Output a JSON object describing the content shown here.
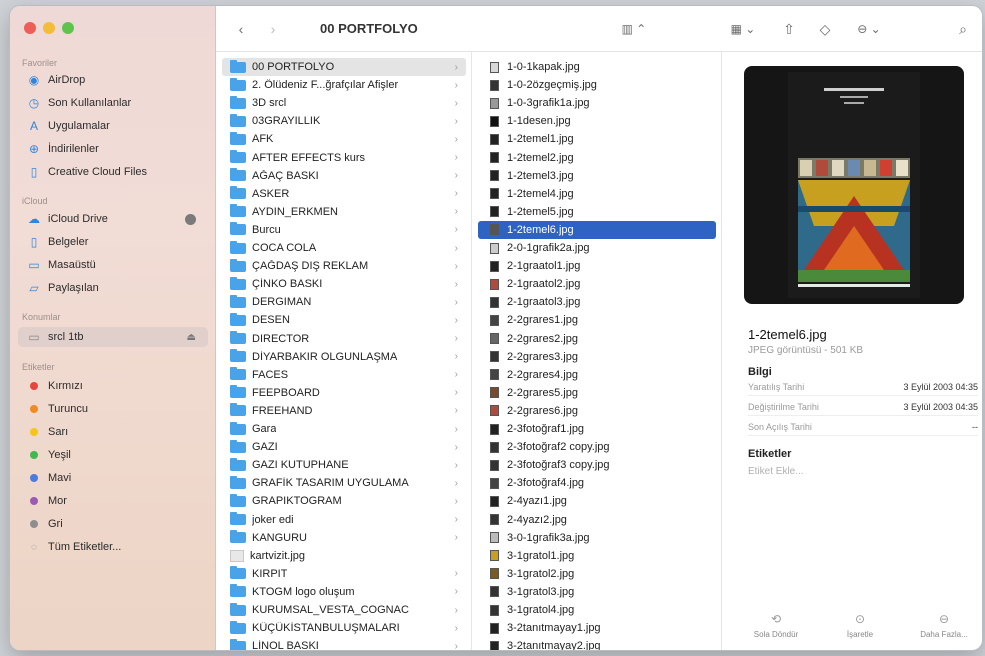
{
  "window_title": "00 PORTFOLYO",
  "sidebar": {
    "sections": {
      "favorites": "Favoriler",
      "icloud": "iCloud",
      "locations": "Konumlar",
      "tags": "Etiketler"
    },
    "favorites": [
      {
        "label": "AirDrop",
        "icon": "airdrop-icon"
      },
      {
        "label": "Son Kullanılanlar",
        "icon": "clock-icon"
      },
      {
        "label": "Uygulamalar",
        "icon": "apps-icon"
      },
      {
        "label": "İndirilenler",
        "icon": "download-icon"
      },
      {
        "label": "Creative Cloud Files",
        "icon": "document-icon"
      }
    ],
    "icloud": [
      {
        "label": "iCloud Drive",
        "icon": "cloud-icon"
      },
      {
        "label": "Belgeler",
        "icon": "document-icon"
      },
      {
        "label": "Masaüstü",
        "icon": "desktop-icon"
      },
      {
        "label": "Paylaşılan",
        "icon": "shared-folder-icon"
      }
    ],
    "locations": [
      {
        "label": "srcl 1tb",
        "icon": "disk-icon"
      }
    ],
    "tags": [
      {
        "label": "Kırmızı",
        "color": "#e8453c"
      },
      {
        "label": "Turuncu",
        "color": "#f08a24"
      },
      {
        "label": "Sarı",
        "color": "#f5c518"
      },
      {
        "label": "Yeşil",
        "color": "#3fb950"
      },
      {
        "label": "Mavi",
        "color": "#4a7be0"
      },
      {
        "label": "Mor",
        "color": "#9b59b6"
      },
      {
        "label": "Gri",
        "color": "#8e8e8e"
      },
      {
        "label": "Tüm Etiketler...",
        "color": ""
      }
    ]
  },
  "column1": [
    "00 PORTFOLYO",
    "2. Ölüdeniz F...ğrafçılar Afişler",
    "3D srcl",
    "03GRAYILLIK",
    "AFK",
    "AFTER EFFECTS kurs",
    "AĞAÇ BASKI",
    "ASKER",
    "AYDIN_ERKMEN",
    "Burcu",
    "COCA COLA",
    "ÇAĞDAŞ DIŞ REKLAM",
    "ÇİNKO BASKI",
    "DERGIMAN",
    "DESEN",
    "DIRECTOR",
    "DİYARBAKIR OLGUNLAŞMA",
    "FACES",
    "FEEPBOARD",
    "FREEHAND",
    "Gara",
    "GAZI",
    "GAZI KUTUPHANE",
    "GRAFİK TASARIM UYGULAMA",
    "GRAPIKTOGRAM",
    "joker edi",
    "KANGURU",
    "kartvizit.jpg",
    "KIRPIT",
    "KTOGM logo oluşum",
    "KURUMSAL_VESTA_COGNAC",
    "KÜÇÜKİSTANBULUŞMALARI",
    "LİNOL BASKI"
  ],
  "column2": [
    "1-0-1kapak.jpg",
    "1-0-2özgeçmiş.jpg",
    "1-0-3grafik1a.jpg",
    "1-1desen.jpg",
    "1-2temel1.jpg",
    "1-2temel2.jpg",
    "1-2temel3.jpg",
    "1-2temel4.jpg",
    "1-2temel5.jpg",
    "1-2temel6.jpg",
    "2-0-1grafik2a.jpg",
    "2-1graatol1.jpg",
    "2-1graatol2.jpg",
    "2-1graatol3.jpg",
    "2-2grares1.jpg",
    "2-2grares2.jpg",
    "2-2grares3.jpg",
    "2-2grares4.jpg",
    "2-2grares5.jpg",
    "2-2grares6.jpg",
    "2-3fotoğraf1.jpg",
    "2-3fotoğraf2 copy.jpg",
    "2-3fotoğraf3 copy.jpg",
    "2-3fotoğraf4.jpg",
    "2-4yazı1.jpg",
    "2-4yazı2.jpg",
    "3-0-1grafik3a.jpg",
    "3-1gratol1.jpg",
    "3-1gratol2.jpg",
    "3-1gratol3.jpg",
    "3-1gratol4.jpg",
    "3-2tanıtmayay1.jpg",
    "3-2tanıtmayay2.jpg"
  ],
  "preview": {
    "file_name": "1-2temel6.jpg",
    "kind": "JPEG görüntüsü - 501 KB",
    "info_heading": "Bilgi",
    "info": [
      {
        "key": "Yaratılış Tarihi",
        "value": "3 Eylül 2003 04:35"
      },
      {
        "key": "Değiştirilme Tarihi",
        "value": "3 Eylül 2003 04:35"
      },
      {
        "key": "Son Açılış Tarihi",
        "value": "--"
      }
    ],
    "tags_heading": "Etiketler",
    "tags_placeholder": "Etiket Ekle...",
    "actions": [
      "Sola Döndür",
      "İşaretle",
      "Daha Fazla..."
    ]
  }
}
